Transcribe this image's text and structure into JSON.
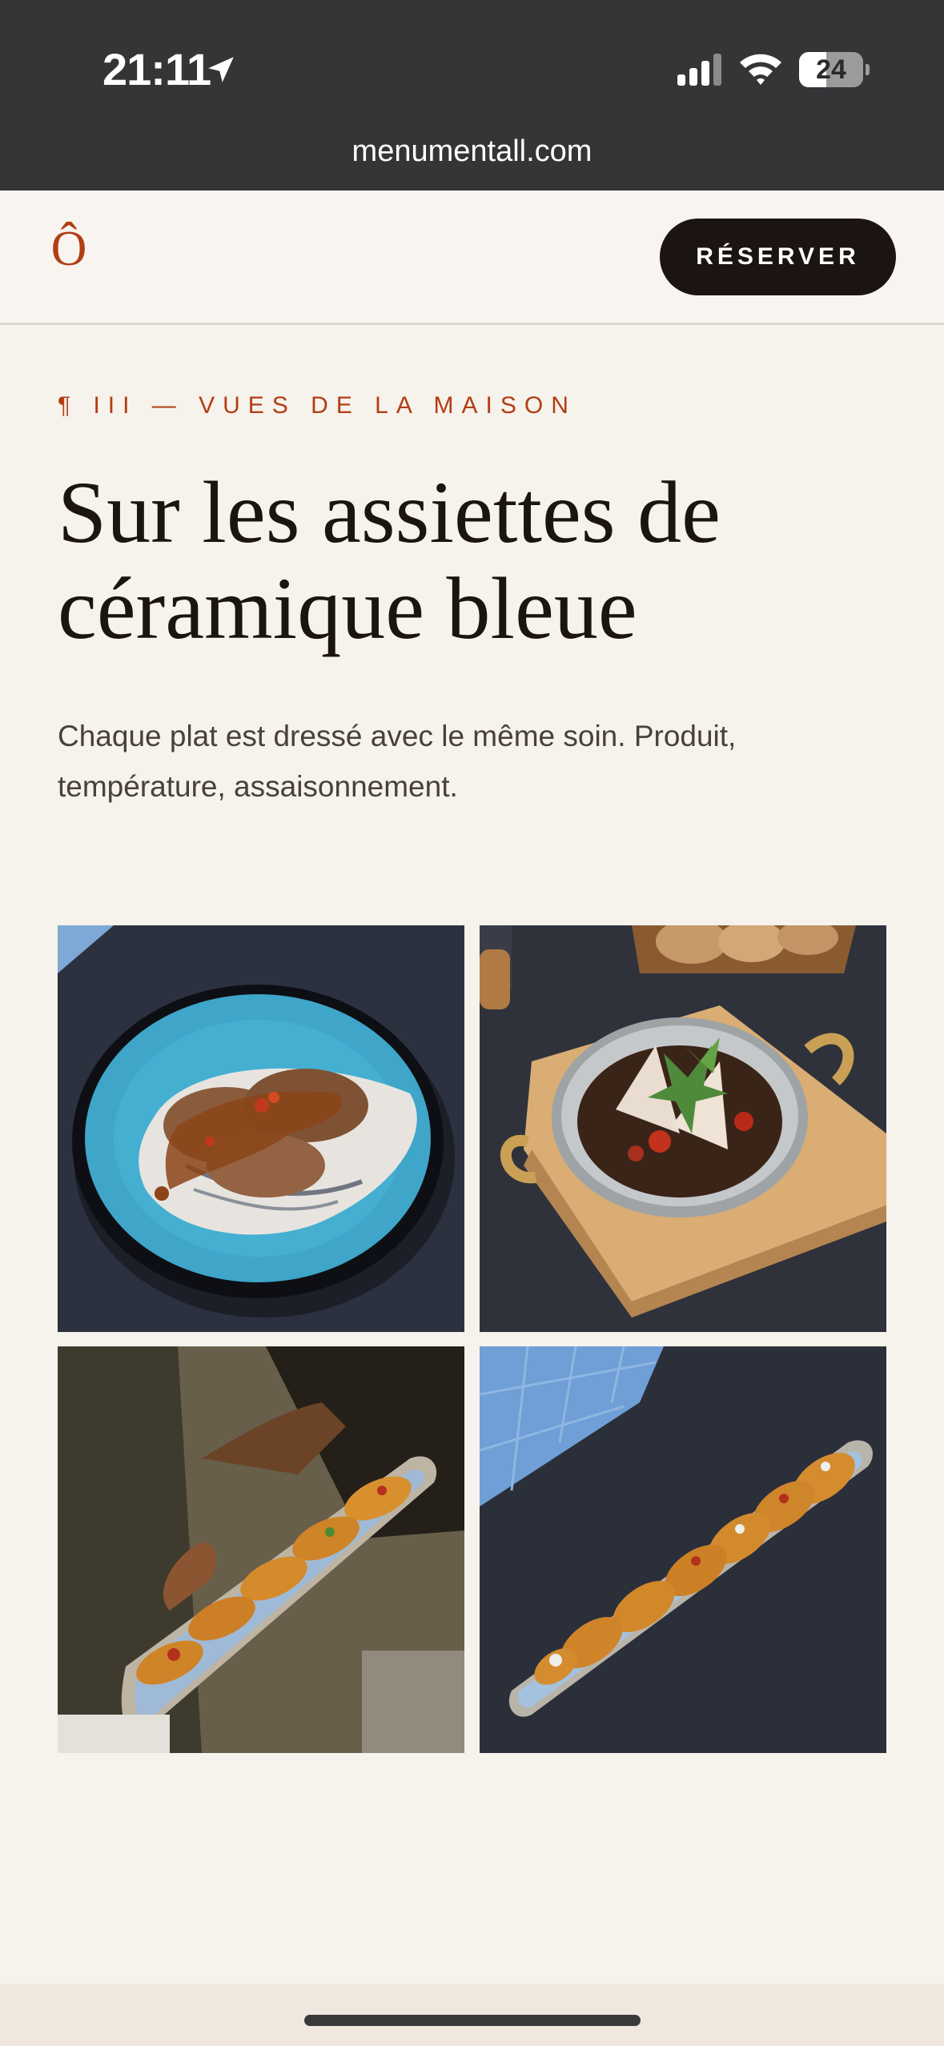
{
  "status_bar": {
    "time": "21:11",
    "battery": "24",
    "url": "menumentall.com"
  },
  "header": {
    "logo": "Ô",
    "reserve_label": "RÉSERVER"
  },
  "section": {
    "eyebrow": "¶ III — VUES DE LA MAISON",
    "title_line1": "Sur les assiettes de",
    "title_line2": "céramique bleue",
    "description": "Chaque plat est dressé avec le même soin. Produit, température, assaisonnement."
  },
  "colors": {
    "accent": "#b23e14",
    "background": "#f6f2ec",
    "button": "#1c1410"
  },
  "icons": [
    "location-arrow-icon",
    "cellular-signal-icon",
    "wifi-icon",
    "battery-icon"
  ]
}
